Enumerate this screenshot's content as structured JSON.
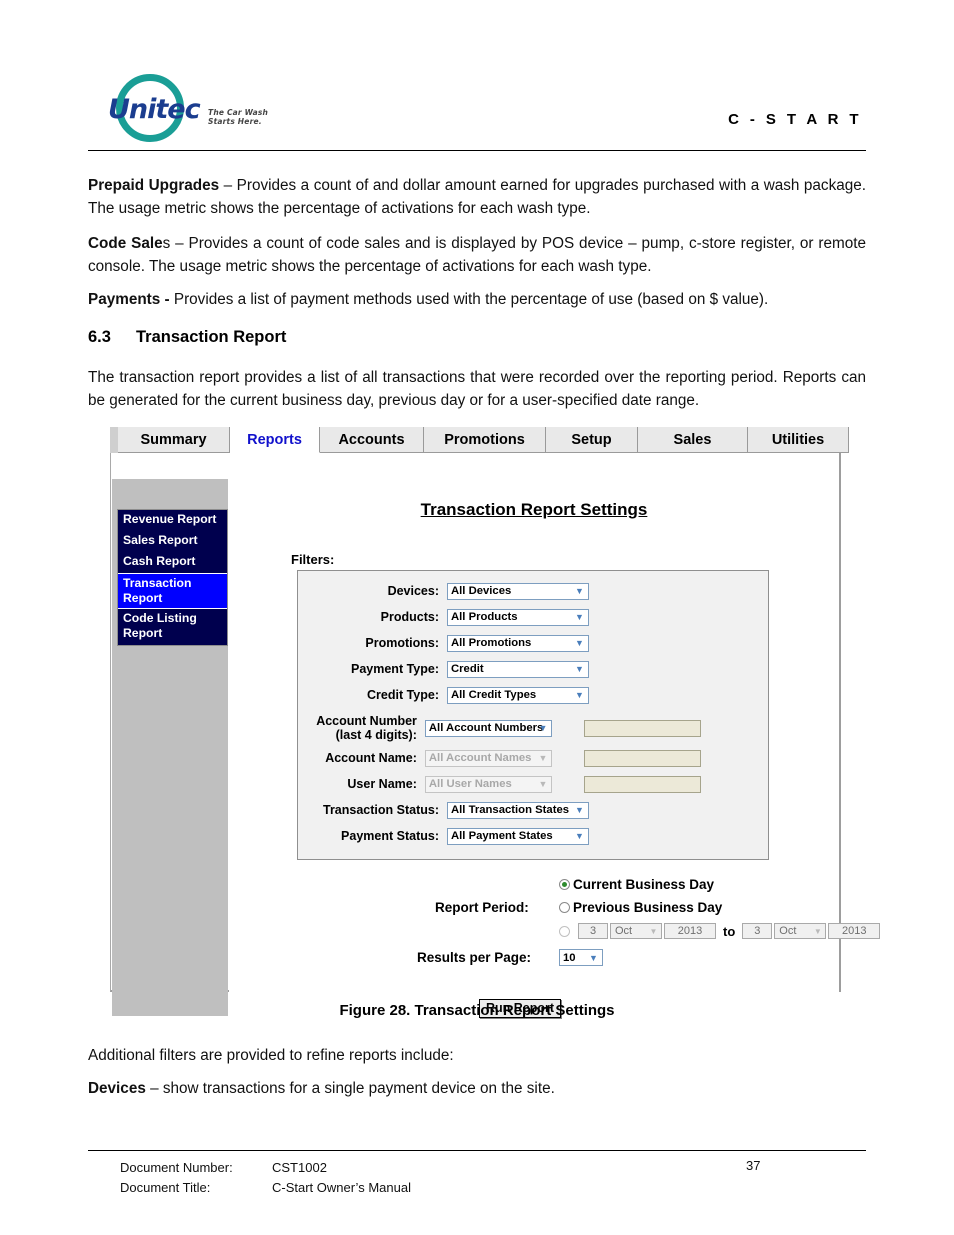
{
  "header": {
    "logo_word": "Unitec",
    "logo_tagline": "The Car Wash Starts Here.",
    "doc_header_title": "C - S T A R T"
  },
  "content": {
    "p_prepaid": "Prepaid Upgrades – Provides a count of and dollar amount earned for upgrades purchased with a wash package. The usage metric shows the percentage of activations for each wash type.",
    "p_prepaid_bold": "Prepaid Upgrades",
    "p_prepaid_rest": " – Provides a count of and dollar amount earned for upgrades purchased with a wash package. The usage metric shows the percentage of activations for each wash type.",
    "p_code_bold": "Code Sale",
    "p_code_rest": "s – Provides a count of code sales and is displayed by POS device – pump, c-store register, or remote console. The usage metric shows the percentage of activations for each wash type.",
    "p_payments_bold": "Payments -",
    "p_payments_rest": " Provides a list of payment methods used with the percentage of use (based on $ value).",
    "section_number": "6.3",
    "section_title": "Transaction Report",
    "p_intro": "The transaction report provides a list of all transactions that were recorded over the reporting period. Reports can be generated for the current business day, previous day or for a user-specified date range.",
    "figure_caption": "Figure 28. Transaction Report Settings",
    "p_additional": "Additional filters are provided to refine reports include:",
    "p_devices_bold": "Devices",
    "p_devices_rest": " – show transactions for a single payment device on the site."
  },
  "app": {
    "tabs": [
      {
        "label": "Summary",
        "active": false
      },
      {
        "label": "Reports",
        "active": true
      },
      {
        "label": "Accounts",
        "active": false
      },
      {
        "label": "Promotions",
        "active": false
      },
      {
        "label": "Setup",
        "active": false
      },
      {
        "label": "Sales",
        "active": false
      },
      {
        "label": "Utilities",
        "active": false
      }
    ],
    "sidebar": [
      {
        "label": "Revenue Report",
        "selected": false
      },
      {
        "label": "Sales Report",
        "selected": false
      },
      {
        "label": "Cash Report",
        "selected": false
      },
      {
        "label": "Transaction Report",
        "selected": true
      },
      {
        "label": "Code Listing Report",
        "selected": false
      }
    ],
    "panel_title": "Transaction Report Settings",
    "filters_label": "Filters:",
    "filters": [
      {
        "label": "Devices:",
        "value": "All Devices",
        "disabled": false,
        "has_text_field": false
      },
      {
        "label": "Products:",
        "value": "All Products",
        "disabled": false,
        "has_text_field": false
      },
      {
        "label": "Promotions:",
        "value": "All Promotions",
        "disabled": false,
        "has_text_field": false
      },
      {
        "label": "Payment Type:",
        "value": "Credit",
        "disabled": false,
        "has_text_field": false
      },
      {
        "label": "Credit Type:",
        "value": "All Credit Types",
        "disabled": false,
        "has_text_field": false
      },
      {
        "label": "Account Number",
        "label2": "(last 4 digits):",
        "value": "All Account Numbers",
        "disabled": false,
        "has_text_field": true
      },
      {
        "label": "Account Name:",
        "value": "All Account Names",
        "disabled": true,
        "has_text_field": true
      },
      {
        "label": "User Name:",
        "value": "All User Names",
        "disabled": true,
        "has_text_field": true
      },
      {
        "label": "Transaction Status:",
        "value": "All Transaction States",
        "disabled": false,
        "has_text_field": false
      },
      {
        "label": "Payment Status:",
        "value": "All Payment States",
        "disabled": false,
        "has_text_field": false
      }
    ],
    "report_period": {
      "label": "Report Period:",
      "option_current": "Current Business Day",
      "option_previous": "Previous Business Day",
      "selected": "Current Business Day",
      "range_from_day": "3",
      "range_from_month": "Oct",
      "range_from_year": "2013",
      "range_to_word": "to",
      "range_to_day": "3",
      "range_to_month": "Oct",
      "range_to_year": "2013"
    },
    "results_per_page_label": "Results per Page:",
    "results_per_page_value": "10",
    "run_button": "Run Report"
  },
  "footer": {
    "doc_number_key": "Document Number:",
    "doc_number_value": "CST1002",
    "doc_title_key": "Document Title:",
    "doc_title_value": "C-Start Owner’s Manual",
    "page_number": "37"
  },
  "colors": {
    "accent_teal": "#1a9e96",
    "logo_blue": "#1b3d8f",
    "tab_active_blue": "#1111cc",
    "sidebar_navy": "#00004e",
    "sidebar_selected": "#0000ff"
  }
}
